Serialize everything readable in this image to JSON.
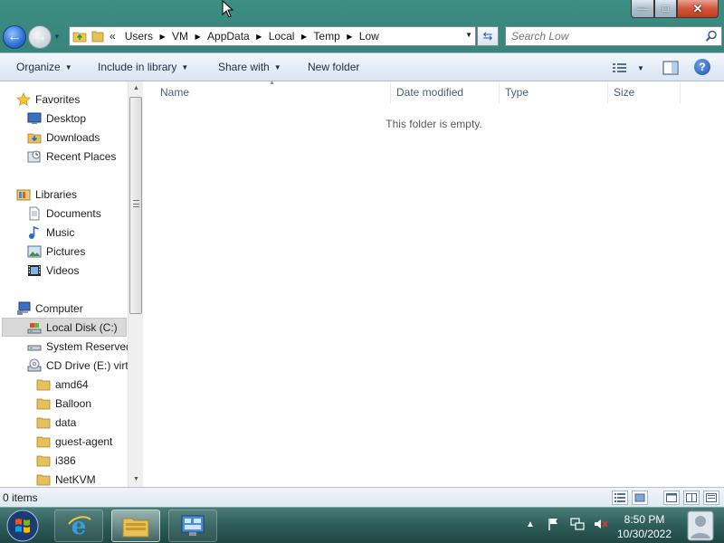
{
  "window": {
    "caption_buttons": {
      "minimize": "—",
      "maximize": "□",
      "close": "✕"
    }
  },
  "navigation": {
    "overflow": "«",
    "breadcrumbs": [
      "Users",
      "VM",
      "AppData",
      "Local",
      "Temp",
      "Low"
    ],
    "search_placeholder": "Search Low"
  },
  "command_bar": {
    "organize": "Organize",
    "include_in_library": "Include in library",
    "share_with": "Share with",
    "new_folder": "New folder"
  },
  "nav_pane": {
    "favorites": {
      "label": "Favorites",
      "items": [
        "Desktop",
        "Downloads",
        "Recent Places"
      ]
    },
    "libraries": {
      "label": "Libraries",
      "items": [
        "Documents",
        "Music",
        "Pictures",
        "Videos"
      ]
    },
    "computer": {
      "label": "Computer",
      "drives": [
        "Local Disk (C:)",
        "System Reserved",
        "CD Drive (E:) virti"
      ],
      "cd_folders": [
        "amd64",
        "Balloon",
        "data",
        "guest-agent",
        "i386",
        "NetKVM"
      ]
    },
    "selected": "Local Disk (C:)"
  },
  "file_list": {
    "columns": [
      "Name",
      "Date modified",
      "Type",
      "Size"
    ],
    "empty_message": "This folder is empty."
  },
  "status_bar": {
    "items_count": "0 items"
  },
  "taskbar": {
    "clock_time": "8:50 PM",
    "clock_date": "10/30/2022"
  },
  "colors": {
    "accent": "#2e6fd6",
    "taskbar": "#2e5d59",
    "command_bar": "#e5eef7",
    "selection": "#d9d9d9"
  }
}
